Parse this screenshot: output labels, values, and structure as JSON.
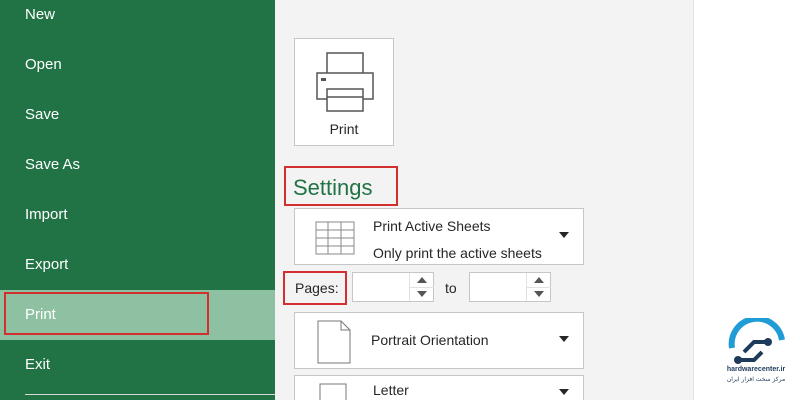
{
  "nav": {
    "items": [
      {
        "label": "New"
      },
      {
        "label": "Open"
      },
      {
        "label": "Save"
      },
      {
        "label": "Save As"
      },
      {
        "label": "Import"
      },
      {
        "label": "Export"
      },
      {
        "label": "Print"
      },
      {
        "label": "Exit"
      }
    ],
    "selected": "Print"
  },
  "print_button": {
    "label": "Print"
  },
  "settings": {
    "title": "Settings",
    "sheets_dropdown": {
      "title": "Print Active Sheets",
      "subtitle": "Only print the active sheets"
    },
    "pages": {
      "label": "Pages:",
      "from_value": "",
      "to_label": "to",
      "to_value": ""
    },
    "orientation_dropdown": {
      "title": "Portrait Orientation"
    },
    "paper_dropdown": {
      "title": "Letter"
    }
  },
  "watermark": {
    "brand": "hardwarecenter.ir",
    "tagline": "مرکز سخت افزار ایران"
  },
  "colors": {
    "nav_bg": "#217346",
    "nav_selected": "#8dc1a1",
    "accent": "#217346",
    "highlight": "#d32f2f"
  }
}
